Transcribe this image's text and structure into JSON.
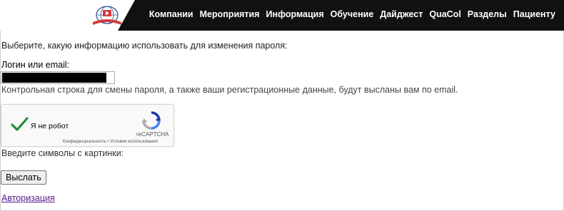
{
  "header": {
    "nav": [
      "Компании",
      "Мероприятия",
      "Информация",
      "Обучение",
      "Дайджест",
      "QuaCol",
      "Разделы",
      "Пациенту"
    ]
  },
  "form": {
    "intro": "Выберите, какую информацию использовать для изменения пароля:",
    "login_label": "Логин или email:",
    "hint": "Контрольная строка для смены пароля, а также ваши регистрационные данные, будут высланы вам по email.",
    "captcha": {
      "label": "Я не робот",
      "brand": "reCAPTCHA",
      "links": "Конфиденциальность • Условия использования"
    },
    "symbols_label": "Введите символы с картинки:",
    "submit": "Выслать",
    "auth_link": "Авторизация"
  },
  "colors": {
    "accent": "#111111",
    "check": "#1e8e3e",
    "link": "#551a8b"
  }
}
